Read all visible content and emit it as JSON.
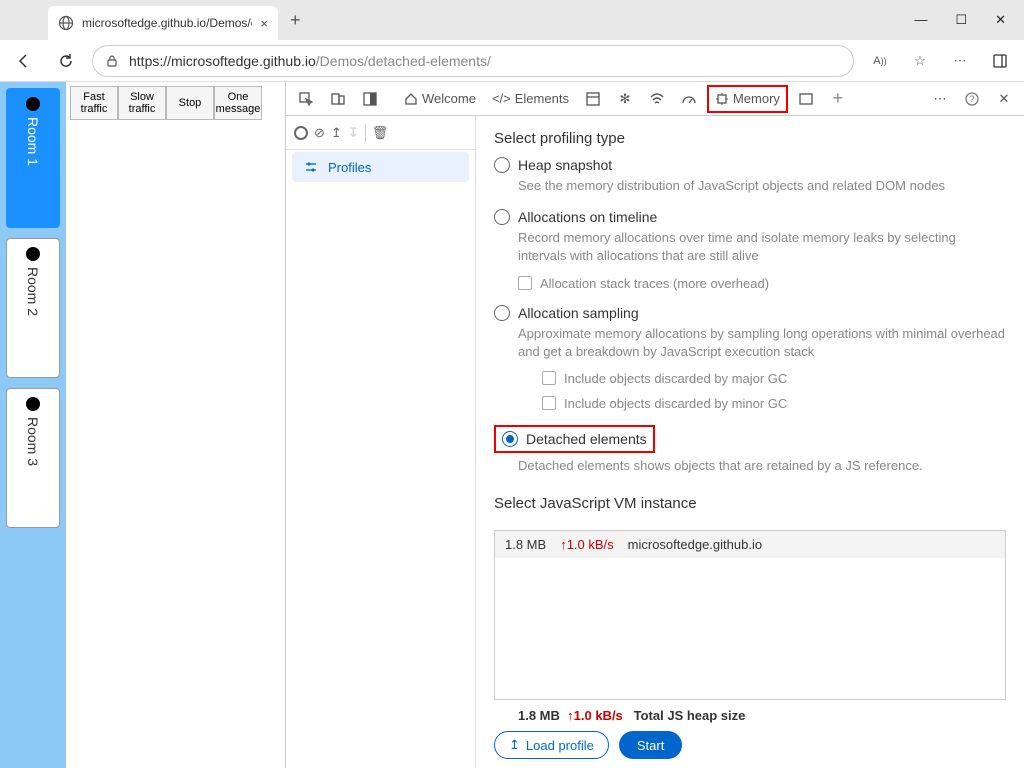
{
  "tab": {
    "title": "microsoftedge.github.io/Demos/c",
    "close": "×",
    "new": "+"
  },
  "url": {
    "prefix": "https://microsoftedge.github.io",
    "path": "/Demos/detached-elements/"
  },
  "rooms": [
    "Room 1",
    "Room 2",
    "Room 3"
  ],
  "page_buttons": [
    "Fast traffic",
    "Slow traffic",
    "Stop",
    "One message"
  ],
  "devtabs": {
    "welcome": "Welcome",
    "elements": "Elements",
    "memory": "Memory"
  },
  "sidebar": {
    "profiles": "Profiles"
  },
  "profiling": {
    "title": "Select profiling type",
    "options": [
      {
        "label": "Heap snapshot",
        "desc": "See the memory distribution of JavaScript objects and related DOM nodes"
      },
      {
        "label": "Allocations on timeline",
        "desc": "Record memory allocations over time and isolate memory leaks by selecting intervals with allocations that are still alive",
        "chk1": "Allocation stack traces (more overhead)"
      },
      {
        "label": "Allocation sampling",
        "desc": "Approximate memory allocations by sampling long operations with minimal overhead and get a breakdown by JavaScript execution stack",
        "chk1": "Include objects discarded by major GC",
        "chk2": "Include objects discarded by minor GC"
      },
      {
        "label": "Detached elements",
        "desc": "Detached elements shows objects that are retained by a JS reference."
      }
    ]
  },
  "vm": {
    "title": "Select JavaScript VM instance",
    "size": "1.8 MB",
    "rate": "↑1.0 kB/s",
    "host": "microsoftedge.github.io"
  },
  "footer": {
    "size": "1.8 MB",
    "rate": "↑1.0 kB/s",
    "label": "Total JS heap size",
    "load": "Load profile",
    "start": "Start"
  }
}
